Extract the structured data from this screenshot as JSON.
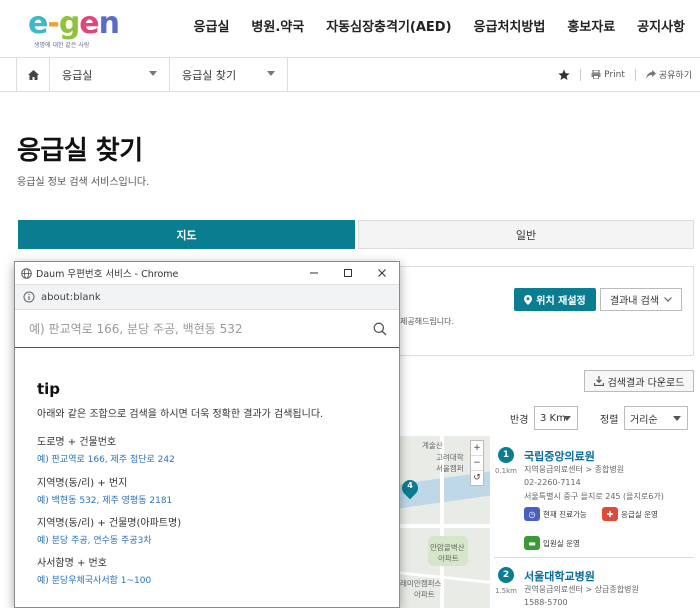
{
  "header": {
    "logo_text": "e-gen",
    "logo_tagline": "생명에 대한 같은 사랑",
    "nav": [
      "응급실",
      "병원.약국",
      "자동심장충격기(AED)",
      "응급처치방법",
      "홍보자료",
      "공지사항"
    ]
  },
  "breadcrumb": {
    "level1": "응급실",
    "level2": "응급실 찾기",
    "print": "Print",
    "share": "공유하기"
  },
  "page": {
    "title": "응급실 찾기",
    "description": "응급실 정보 검색 서비스입니다."
  },
  "tabs": [
    "지도",
    "일반"
  ],
  "search_panel": {
    "reset_location": "위치 재설정",
    "search_in_results": "결과내 검색",
    "info_text": "제공해드립니다.",
    "download": "검색결과 다운로드"
  },
  "filters": {
    "radius_label": "반경",
    "radius_value": "3 Km",
    "sort_label": "정렬",
    "sort_value": "거리순"
  },
  "map": {
    "labels": [
      "계술산",
      "고려대학",
      "서울캠퍼",
      "안암골벽산",
      "아파트",
      "래미안캠퍼스",
      "아파트"
    ],
    "marker_number": "4",
    "zoom": [
      "+",
      "−",
      "↺"
    ]
  },
  "results": [
    {
      "number": "1",
      "distance": "0.1km",
      "name": "국립중앙의료원",
      "type": "지역응급의료센터 > 종합병원",
      "phone": "02-2260-7114",
      "address": "서울특별시 중구 을지로 245 (을지로6가)",
      "badges": [
        "현재 진료가능",
        "응급실 운영",
        "입원실 운영"
      ]
    },
    {
      "number": "2",
      "distance": "1.5km",
      "name": "서울대학교병원",
      "type": "권역응급의료센터 > 상급종합병원",
      "phone": "1588-5700"
    }
  ],
  "popup": {
    "window_title": "Daum 우편번호 서비스 - Chrome",
    "url": "about:blank",
    "search_placeholder": "예) 판교역로 166, 분당 주공, 백현동 532",
    "tip_title": "tip",
    "tip_description": "아래와 같은 조합으로 검색을 하시면 더욱 정확한 결과가 검색됩니다.",
    "tips": [
      {
        "heading": "도로명 + 건물번호",
        "example": "예) 판교역로 166,  제주 첨단로 242"
      },
      {
        "heading": "지역명(동/리) + 번지",
        "example": "예) 백현동 532,  제주 영평동 2181"
      },
      {
        "heading": "지역명(동/리) + 건물명(아파트명)",
        "example": "예) 분당 주공,  연수동 주공3차"
      },
      {
        "heading": "사서함명 + 번호",
        "example": "예) 분당우체국사서함 1~100"
      }
    ]
  },
  "colors": {
    "accent": "#0b7d91",
    "link": "#0b6b9a",
    "example_text": "#2b73b8"
  }
}
